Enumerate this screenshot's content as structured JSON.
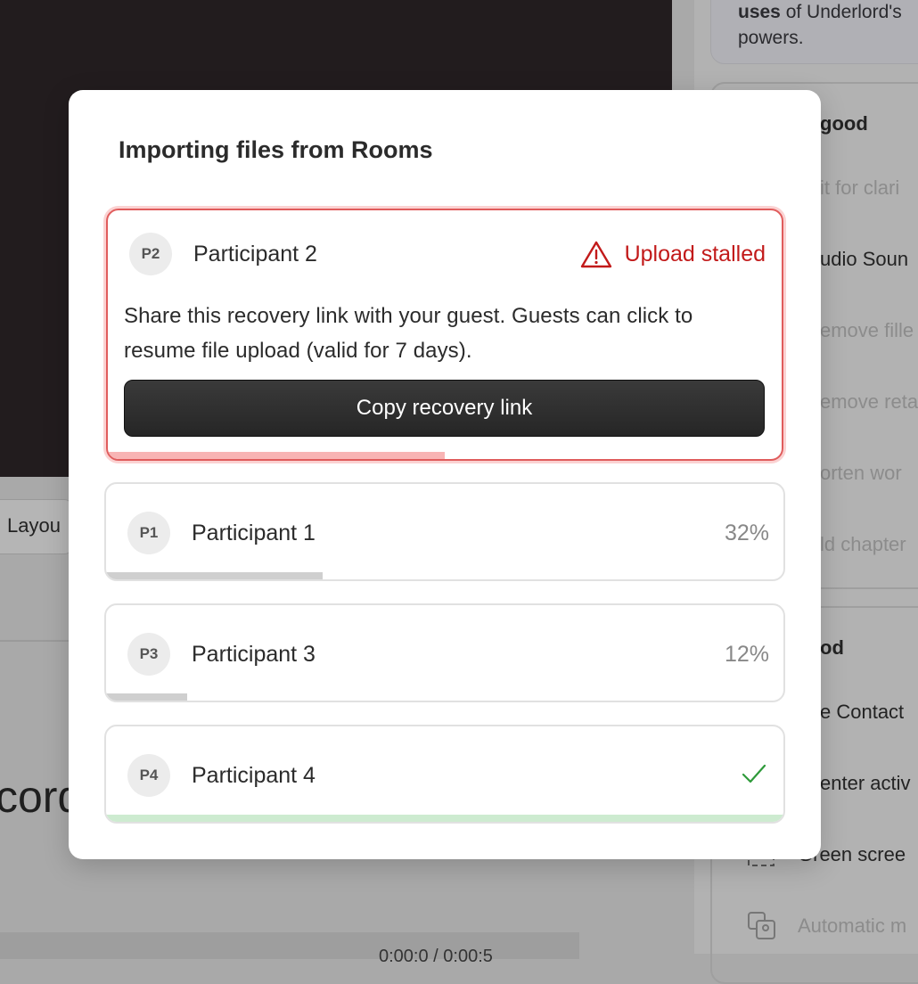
{
  "background": {
    "tip": {
      "bold": "uses",
      "rest": " of Underlord's",
      "line2": "powers."
    },
    "section1_heading": "good",
    "section1_items": [
      "it for clari",
      "udio Soun",
      "emove fille",
      "emove reta",
      "orten wor",
      "ld chapter"
    ],
    "section2_heading": "od",
    "section2_items": [
      "e Contact",
      "enter activ",
      "Green scree",
      "Automatic m"
    ],
    "layout_button": "Layou",
    "big_text": "cord",
    "bottom_text": "0:00:0 / 0:00:5"
  },
  "modal": {
    "title": "Importing files from Rooms",
    "participants": [
      {
        "initials": "P2",
        "name": "Participant 2",
        "status": "Upload stalled",
        "message": "Share this recovery link with your guest. Guests can click to resume file upload (valid for 7 days).",
        "button": "Copy recovery link",
        "progress": 0.5,
        "progress_color": "#f8b4b4"
      },
      {
        "initials": "P1",
        "name": "Participant 1",
        "percent": "32%",
        "progress": 0.32,
        "progress_color": "#cfcfcf"
      },
      {
        "initials": "P3",
        "name": "Participant 3",
        "percent": "12%",
        "progress": 0.12,
        "progress_color": "#cfcfcf"
      },
      {
        "initials": "P4",
        "name": "Participant 4",
        "status": "complete",
        "icon": "checkmark-icon",
        "progress": 1.0,
        "progress_color": "#cdebd0"
      }
    ]
  },
  "colors": {
    "error": "#c21a1a",
    "success": "#2e9a3a",
    "stalled_border": "#e05c5c"
  }
}
